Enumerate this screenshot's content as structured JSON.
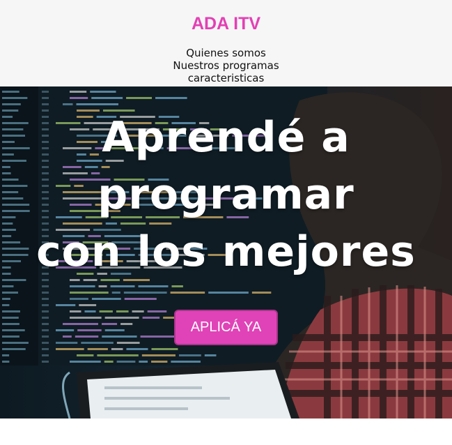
{
  "brand": {
    "name": "ADA ITV",
    "color": "#e340b4"
  },
  "nav": {
    "items": [
      {
        "label": "Quienes somos"
      },
      {
        "label": "Nuestros programas"
      },
      {
        "label": "caracteristicas"
      }
    ]
  },
  "hero": {
    "headline_lines": [
      "Aprendé a",
      "programar",
      "con los mejores"
    ],
    "background_icon": "person-coding-photo",
    "cta": {
      "label": "APLICÁ YA",
      "color": "#e043b7"
    }
  }
}
